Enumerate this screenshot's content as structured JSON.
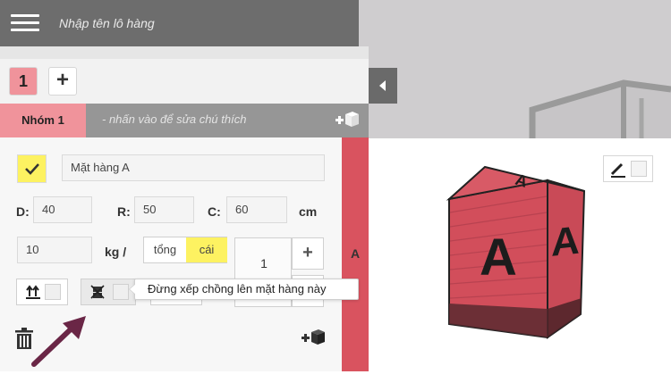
{
  "header": {
    "shipment_name_placeholder": "Nhập tên lô hàng",
    "menu_icon": "hamburger-icon"
  },
  "tabs": {
    "active_label": "1",
    "add_label": "+"
  },
  "group": {
    "name": "Nhóm 1",
    "comment_hint": "- nhấn vào để sửa chú thích"
  },
  "item": {
    "name": "Mặt hàng A",
    "checked": true,
    "dimensions": {
      "d_label": "D:",
      "d_value": "40",
      "r_label": "R:",
      "r_value": "50",
      "c_label": "C:",
      "c_value": "60",
      "unit": "cm"
    },
    "weight": {
      "value": "10",
      "unit": "kg /",
      "mode_total": "tổng",
      "mode_piece": "cái",
      "mode_selected": "cái"
    },
    "quantity": {
      "value": "1"
    },
    "side_label": "A",
    "tooltip": "Đừng xếp chồng lên mặt hàng này"
  },
  "preview": {
    "box_letter": "A"
  },
  "colors": {
    "accent_red": "#d9535f",
    "tab_pink": "#f0939b",
    "highlight_yellow": "#fdf261",
    "header_grey": "#6d6d6d",
    "arrow_purple": "#6a2646",
    "box_front": "#d24e5b"
  }
}
